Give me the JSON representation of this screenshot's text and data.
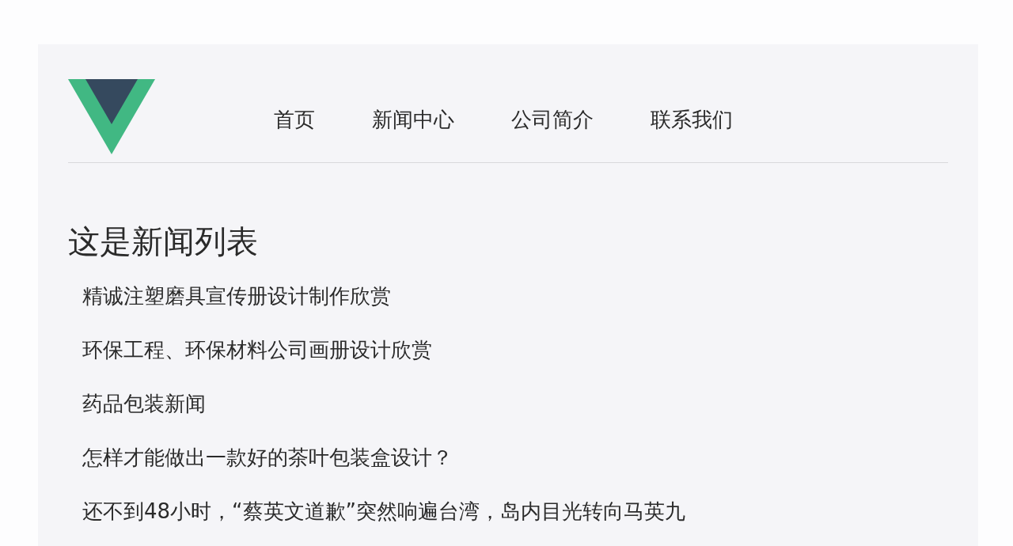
{
  "nav": [
    {
      "label": "首页"
    },
    {
      "label": "新闻中心"
    },
    {
      "label": "公司简介"
    },
    {
      "label": "联系我们"
    }
  ],
  "heading": "这是新闻列表",
  "news": [
    "精诚注塑磨具宣传册设计制作欣赏",
    "环保工程、环保材料公司画册设计欣赏",
    "药品包装新闻",
    "怎样才能做出一款好的茶叶包装盒设计？",
    "还不到48小时，“蔡英文道歉”突然响遍台湾，岛内目光转向马英九"
  ]
}
